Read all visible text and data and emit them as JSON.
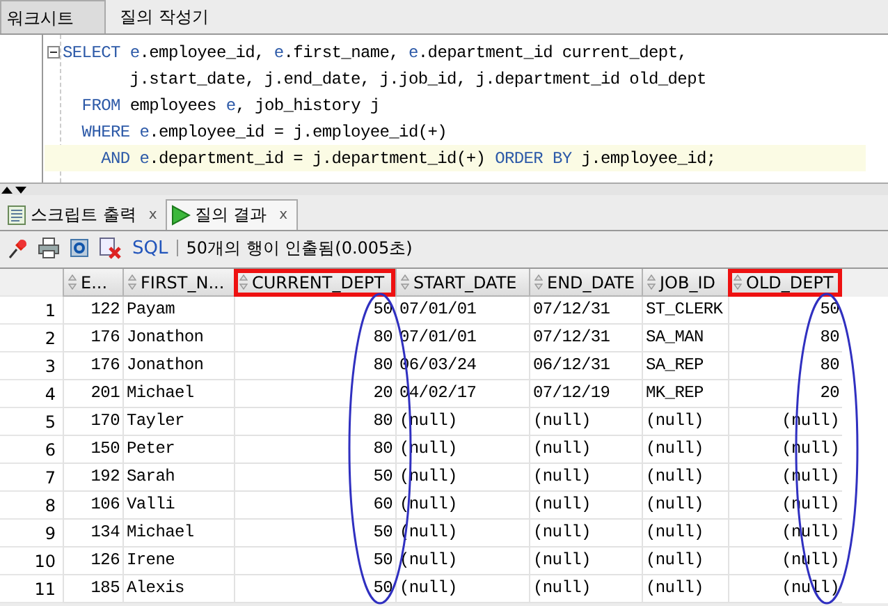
{
  "worksheet_tabs": [
    {
      "label": "워크시트",
      "selected": true
    },
    {
      "label": "질의 작성기",
      "selected": false
    }
  ],
  "editor": {
    "lines": [
      {
        "current": false,
        "fold": true,
        "segments": [
          {
            "text": "SELECT",
            "kind": "keyword"
          },
          {
            "text": " e",
            "kind": "alias"
          },
          {
            "text": ".employee_id, ",
            "kind": "plain"
          },
          {
            "text": "e",
            "kind": "alias"
          },
          {
            "text": ".first_name, ",
            "kind": "plain"
          },
          {
            "text": "e",
            "kind": "alias"
          },
          {
            "text": ".department_id current_dept,",
            "kind": "plain"
          }
        ]
      },
      {
        "current": false,
        "fold": false,
        "segments": [
          {
            "text": "       j.start_date, j.end_date, j.job_id, j.department_id old_dept",
            "kind": "plain"
          }
        ]
      },
      {
        "current": false,
        "fold": false,
        "segments": [
          {
            "text": "  FROM",
            "kind": "keyword"
          },
          {
            "text": " employees ",
            "kind": "plain"
          },
          {
            "text": "e",
            "kind": "alias"
          },
          {
            "text": ", job_history j",
            "kind": "plain"
          }
        ]
      },
      {
        "current": false,
        "fold": false,
        "segments": [
          {
            "text": "  WHERE",
            "kind": "keyword"
          },
          {
            "text": " e",
            "kind": "alias"
          },
          {
            "text": ".employee_id = j.employee_id(+)",
            "kind": "plain"
          }
        ]
      },
      {
        "current": true,
        "fold": false,
        "segments": [
          {
            "text": "    AND",
            "kind": "keyword"
          },
          {
            "text": " e",
            "kind": "alias"
          },
          {
            "text": ".department_id = j.department_id(+) ",
            "kind": "plain"
          },
          {
            "text": "ORDER BY",
            "kind": "keyword"
          },
          {
            "text": " j.employee_id;",
            "kind": "plain"
          }
        ]
      }
    ]
  },
  "output_tabs": [
    {
      "label": "스크립트 출력",
      "close": "x",
      "selected": false
    },
    {
      "label": "질의 결과",
      "close": "x",
      "selected": true
    }
  ],
  "toolbar": {
    "sql_link": "SQL",
    "message": "50개의 행이 인출됨(0.005초)"
  },
  "grid": {
    "columns": [
      {
        "label": "E...",
        "kind": "number",
        "highlighted": false
      },
      {
        "label": "FIRST_N...",
        "kind": "text",
        "highlighted": false
      },
      {
        "label": "CURRENT_DEPT",
        "kind": "number",
        "highlighted": true
      },
      {
        "label": "START_DATE",
        "kind": "text",
        "highlighted": false
      },
      {
        "label": "END_DATE",
        "kind": "text",
        "highlighted": false
      },
      {
        "label": "JOB_ID",
        "kind": "text",
        "highlighted": false
      },
      {
        "label": "OLD_DEPT",
        "kind": "number",
        "highlighted": true
      }
    ],
    "rows": [
      {
        "number": "1",
        "cells": [
          "122",
          "Payam",
          "50",
          "07/01/01",
          "07/12/31",
          "ST_CLERK",
          "50"
        ]
      },
      {
        "number": "2",
        "cells": [
          "176",
          "Jonathon",
          "80",
          "07/01/01",
          "07/12/31",
          "SA_MAN",
          "80"
        ]
      },
      {
        "number": "3",
        "cells": [
          "176",
          "Jonathon",
          "80",
          "06/03/24",
          "06/12/31",
          "SA_REP",
          "80"
        ]
      },
      {
        "number": "4",
        "cells": [
          "201",
          "Michael",
          "20",
          "04/02/17",
          "07/12/19",
          "MK_REP",
          "20"
        ]
      },
      {
        "number": "5",
        "cells": [
          "170",
          "Tayler",
          "80",
          "(null)",
          "(null)",
          "(null)",
          "(null)"
        ]
      },
      {
        "number": "6",
        "cells": [
          "150",
          "Peter",
          "80",
          "(null)",
          "(null)",
          "(null)",
          "(null)"
        ]
      },
      {
        "number": "7",
        "cells": [
          "192",
          "Sarah",
          "50",
          "(null)",
          "(null)",
          "(null)",
          "(null)"
        ]
      },
      {
        "number": "8",
        "cells": [
          "106",
          "Valli",
          "60",
          "(null)",
          "(null)",
          "(null)",
          "(null)"
        ]
      },
      {
        "number": "9",
        "cells": [
          "134",
          "Michael",
          "50",
          "(null)",
          "(null)",
          "(null)",
          "(null)"
        ]
      },
      {
        "number": "10",
        "cells": [
          "126",
          "Irene",
          "50",
          "(null)",
          "(null)",
          "(null)",
          "(null)"
        ]
      },
      {
        "number": "11",
        "cells": [
          "185",
          "Alexis",
          "50",
          "(null)",
          "(null)",
          "(null)",
          "(null)"
        ]
      }
    ]
  }
}
